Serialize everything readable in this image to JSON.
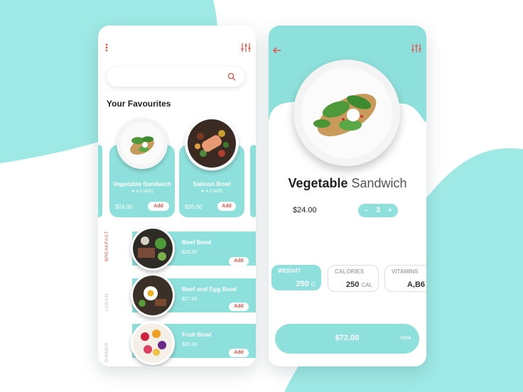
{
  "colors": {
    "accent": "#e2574c",
    "mint": "#8ee0dc",
    "mint_bg": "#9ee9e6"
  },
  "left_phone": {
    "menu_icon": "kebab-menu-icon",
    "filter_icon": "sliders-icon",
    "search": {
      "placeholder": "",
      "icon": "search-icon"
    },
    "favourites_title": "Your Favourites",
    "cards": [
      {
        "name": "Vegetable Sandwich",
        "rating": "★ 4.5  (405)",
        "price": "$24.00",
        "add_label": "Add"
      },
      {
        "name": "Salmon Bowl",
        "rating": "★ 4.5  (405)",
        "price": "$26.00",
        "add_label": "Add"
      }
    ],
    "categories": [
      "BREAKFAST",
      "LUNCH",
      "DINNER"
    ],
    "meals": [
      {
        "name": "Beef Bowl",
        "price": "$25.00",
        "add_label": "Add"
      },
      {
        "name": "Beef and Egg Bowl",
        "price": "$27.00",
        "add_label": "Add"
      },
      {
        "name": "Fruit Bowl",
        "price": "$20.00",
        "add_label": "Add"
      }
    ]
  },
  "right_phone": {
    "back_icon": "back-arrow-icon",
    "filter_icon": "sliders-icon",
    "title_bold": "Vegetable",
    "title_light": "Sandwich",
    "price": "$24.00",
    "quantity": {
      "minus": "−",
      "value": "3",
      "plus": "+"
    },
    "nutrition": [
      {
        "label": "WEIGHT",
        "value": "250",
        "unit": "G"
      },
      {
        "label": "CALORIES",
        "value": "250",
        "unit": "CAL"
      },
      {
        "label": "VITAMINS",
        "value": "A,B6",
        "unit": ""
      }
    ],
    "checkout": {
      "total": "$72.00",
      "arrows": "›››››"
    }
  }
}
